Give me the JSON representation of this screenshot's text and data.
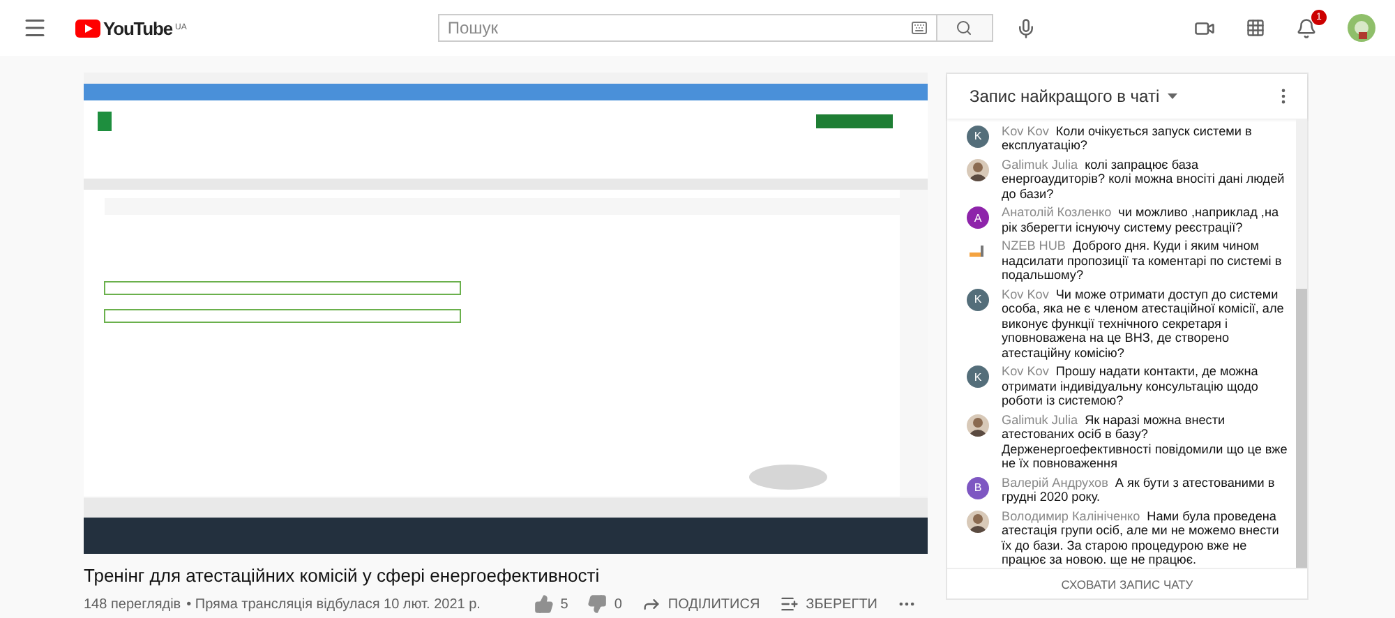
{
  "header": {
    "logo": "YouTube",
    "region": "UA",
    "search": {
      "placeholder": "Пошук"
    },
    "notifications": "1"
  },
  "video": {
    "kind": "picture",
    "title": "Тренінг для атестаційних комісій у сфері енергоефективності",
    "views": "148 переглядів",
    "meta": "• Пряма трансляція відбулася 10 лют. 2021 р.",
    "likes": "5",
    "dislikes": "0",
    "actions": [
      {
        "kind": "share",
        "label": "ПОДІЛИТИСЯ"
      },
      {
        "kind": "save",
        "label": "ЗБЕРЕГТИ"
      }
    ]
  },
  "chat": {
    "title": "Запис найкращого в чаті",
    "messages": [
      {
        "author": "Kov Kov",
        "text": "Коли очікується запуск системи в експлуатацію?",
        "avatar": {
          "kind": "letter",
          "letter": "K",
          "color": "#546e7a"
        }
      },
      {
        "author": "Galimuk Julia",
        "text": "колі запрацює база енергоаудиторів? колі можна вносіті дані людей до бази?"
      },
      {
        "author": "Анатолій Козленко",
        "text": "чи можливо ,наприклад ,на рік зберегти існуючу систему реєстрації?",
        "avatar": {
          "kind": "letter",
          "letter": "A",
          "color": "#8e24aa"
        }
      },
      {
        "author": "NZEB HUB",
        "text": "Доброго дня. Куди і яким чином надсилати пропозиції та коментарі по системі в подальшому?",
        "avatar": {
          "kind": "logo"
        }
      },
      {
        "author": "Kov Kov",
        "text": "Чи може отримати доступ до системи особа, яка не є членом атестаційної комісії, але виконує функції технічного секретаря і уповноважена на це ВНЗ, де створено атестаційну комісію?",
        "avatar": {
          "kind": "letter",
          "letter": "K",
          "color": "#546e7a"
        }
      },
      {
        "author": "Kov Kov",
        "text": "Прошу надати контакти, де можна отримати індивідуальну консультацію щодо роботи із системою?",
        "avatar": {
          "kind": "letter",
          "letter": "K",
          "color": "#546e7a"
        }
      },
      {
        "author": "Galimuk Julia",
        "text": "Як наразі можна внести атестованих осіб в базу? Держенергоефективності повідомили що це вже не їх повноваження"
      },
      {
        "author": "Валерій Андрухов",
        "text": "А як бути з атестованими в грудні 2020 року.",
        "avatar": {
          "kind": "letter",
          "letter": "B",
          "color": "#7e57c2"
        }
      },
      {
        "author": "Володимир Калініченко",
        "text": "Нами була проведена атестація групи осіб, але ми не можемо внести їх до бази. За старою процедурою вже не працює за новою. ще не працює."
      }
    ],
    "hide_button": "СХОВАТИ ЗАПИС ЧАТУ"
  }
}
